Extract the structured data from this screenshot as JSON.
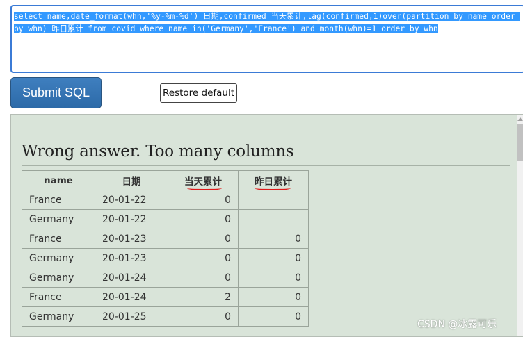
{
  "sql_input": {
    "value": "select name,date_format(whn,'%y-%m-%d') 日期,confirmed 当天累计,lag(confirmed,1)over(partition by name order by whn) 昨日累计 from covid where name in('Germany','France') and month(whn)=1 order by whn"
  },
  "buttons": {
    "submit_label": "Submit SQL",
    "restore_label": "Restore default"
  },
  "result": {
    "message": "Wrong answer. Too many columns",
    "columns": [
      "name",
      "日期",
      "当天累计",
      "昨日累计"
    ],
    "rows": [
      [
        "France",
        "20-01-22",
        "0",
        ""
      ],
      [
        "Germany",
        "20-01-22",
        "0",
        ""
      ],
      [
        "France",
        "20-01-23",
        "0",
        "0"
      ],
      [
        "Germany",
        "20-01-23",
        "0",
        "0"
      ],
      [
        "Germany",
        "20-01-24",
        "0",
        "0"
      ],
      [
        "France",
        "20-01-24",
        "2",
        "0"
      ],
      [
        "Germany",
        "20-01-25",
        "0",
        "0"
      ]
    ]
  },
  "watermark": "CSDN @冰露可乐",
  "colors": {
    "selection": "#3399ff",
    "submit_bg": "#2c6aa8",
    "panel_bg": "#d9e4d9",
    "annotation": "#e0191a"
  }
}
